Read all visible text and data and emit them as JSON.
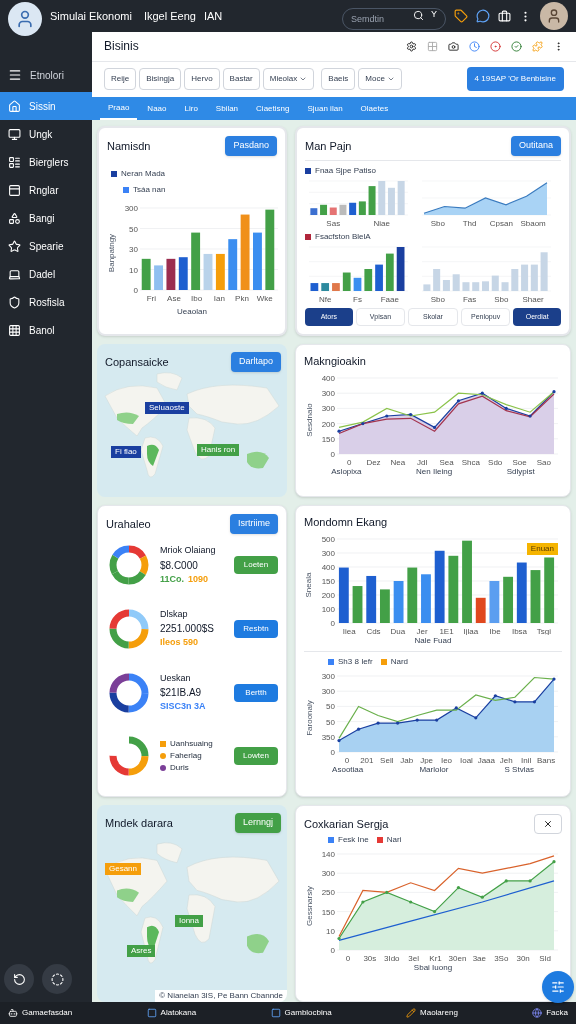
{
  "app": {
    "title": "Simulai Ekonomi",
    "subtitle": "Ikgel Eeng",
    "user_code": "IAN"
  },
  "search": {
    "placeholder": "Semdtin",
    "shortcut": "Y"
  },
  "sidebar": {
    "header": "Etnolori",
    "items": [
      {
        "label": "Sissin",
        "selected": true
      },
      {
        "label": "Ungk",
        "selected": false
      },
      {
        "label": "Bierglers",
        "selected": false
      },
      {
        "label": "Rnglar",
        "selected": false
      },
      {
        "label": "Bangi",
        "selected": false
      },
      {
        "label": "Spearie",
        "selected": false
      },
      {
        "label": "Dadel",
        "selected": false
      },
      {
        "label": "Rosfisla",
        "selected": false
      },
      {
        "label": "Banol",
        "selected": false
      }
    ]
  },
  "page": {
    "title": "Bisinis"
  },
  "toolbar": [
    {
      "label": "Reije",
      "kind": "plain"
    },
    {
      "label": "Bisingja",
      "kind": "plain"
    },
    {
      "label": "Hervo",
      "kind": "plain"
    },
    {
      "label": "Bastar",
      "kind": "plain"
    },
    {
      "label": "Mieolax",
      "kind": "dropdown"
    },
    {
      "label": "Baeis",
      "kind": "plain"
    },
    {
      "label": "Moce",
      "kind": "dropdown"
    },
    {
      "label": "4 19SAP 'Or Benbisine",
      "kind": "primary"
    }
  ],
  "tabs": [
    {
      "label": "Praao",
      "selected": true
    },
    {
      "label": "Naao",
      "selected": false
    },
    {
      "label": "Liro",
      "selected": false
    },
    {
      "label": "Sbilan",
      "selected": false
    },
    {
      "label": "Ciaetisng",
      "selected": false
    },
    {
      "label": "Sjuan ilan",
      "selected": false
    },
    {
      "label": "Olaetes",
      "selected": false
    }
  ],
  "bar_panel": {
    "title": "Namisdn",
    "button": "Pasdano",
    "legend": [
      {
        "label": "Neran Mada",
        "color": "#1a3fa0"
      },
      {
        "label": "Tsáa nan",
        "color": "#3b82f6"
      }
    ],
    "yticks": [
      "300",
      "50",
      "30",
      "10",
      "0"
    ],
    "xlabels": [
      "Fri",
      "Ase",
      "Ibo",
      "Ian",
      "Pkn",
      "Wke"
    ],
    "ylabel": "Banpatngy",
    "xlabel": "Ueaolan"
  },
  "multi_panel": {
    "title": "Man Pajn",
    "button": "Outitana",
    "legend_top": {
      "label": "Fnaa Sjpe Patiso",
      "color": "#1a3fa0"
    },
    "top_left_x": [
      "Sas",
      "Niae"
    ],
    "top_right_x": [
      "Sbo",
      "Thd",
      "Cpsan",
      "Sbaom"
    ],
    "legend_bottom": {
      "label": "Fsacfston BlelA",
      "color": "#b0263b"
    },
    "bottom_left_x": [
      "Nfe",
      "Fs",
      "Faae"
    ],
    "bottom_right_x": [
      "Sbo",
      "Fas",
      "Sbo",
      "Shaer"
    ],
    "segments": [
      {
        "label": "Ators",
        "selected": true
      },
      {
        "label": "Vpisan",
        "selected": false
      },
      {
        "label": "Skolar",
        "selected": false
      },
      {
        "label": "Penlopuv",
        "selected": false
      },
      {
        "label": "Oerdiat",
        "selected": true
      }
    ]
  },
  "map_panel": {
    "title": "Copansaicke",
    "button": "Darltapo",
    "labels": [
      {
        "text": "Seluaoste",
        "color": "#1a3fa0"
      },
      {
        "text": "Fi flao",
        "color": "#1a3fa0"
      },
      {
        "text": "Hanis ron",
        "color": "#43a047"
      }
    ]
  },
  "line_panel": {
    "title": "Makngioakin",
    "yticks": [
      "400",
      "300",
      "300",
      "200",
      "150",
      "0"
    ],
    "xlabels": [
      "0",
      "Dez",
      "Nea",
      "Jdl",
      "Sea",
      "Shca",
      "Sdo",
      "Soe",
      "Sao"
    ],
    "ylabel": "Sesdnalo",
    "groups": [
      "Aslopixa",
      "Nen Ileing",
      "Sdlypist"
    ]
  },
  "summary_panel": {
    "title": "Urahaleo",
    "button": "Isrtriime",
    "items": [
      {
        "kind": "stat",
        "title": "Mriok Olaiang",
        "value": "$8.C000",
        "detail": [
          {
            "text": "11Co.",
            "color": "#43a047"
          },
          {
            "text": "1090",
            "color": "#f59e0b"
          }
        ],
        "button": {
          "label": "Loeten",
          "color": "#43a047"
        }
      },
      {
        "kind": "stat",
        "title": "Dlskap",
        "value": "2251.000$S",
        "detail": [
          {
            "text": "Ileos 590",
            "color": "#f59e0b"
          }
        ],
        "button": {
          "label": "Resbtn",
          "color": "#1e7be0"
        }
      },
      {
        "kind": "stat",
        "title": "Ueskan",
        "value": "$21IB.A9",
        "detail": [
          {
            "text": "SISC3n 3A",
            "color": "#3b82f6"
          }
        ],
        "button": {
          "label": "Bertth",
          "color": "#1e7be0"
        }
      },
      {
        "kind": "legend",
        "legend": [
          {
            "label": "Uanhsuaing",
            "color": "#f59e0b",
            "round": false
          },
          {
            "label": "Faherlag",
            "color": "#f59e0b",
            "round": true
          },
          {
            "label": "Duris",
            "color": "#7b3f98",
            "round": true
          }
        ],
        "button": {
          "label": "Lowten",
          "color": "#43a047"
        }
      }
    ]
  },
  "combo_panel": {
    "title": "Mondomn Ekang",
    "badge": "Enuan",
    "bar_yticks": [
      "500",
      "300",
      "400",
      "150",
      "200",
      "100",
      "0"
    ],
    "bar_xlabels": [
      "Iiea",
      "Cds",
      "Dua",
      "Jer",
      "1E1",
      "Ijlaa",
      "Ibe",
      "Ibsa",
      "Tsgi"
    ],
    "bar_ylabel": "Sneala",
    "bar_xlabel": "Nale Fuad",
    "legend": [
      {
        "label": "Sh3 8 Iefr",
        "color": "#3b82f6"
      },
      {
        "label": "Nard",
        "color": "#f59e0b"
      }
    ],
    "line_yticks": [
      "300",
      "300",
      "50",
      "50",
      "350",
      "0"
    ],
    "line_xlabels": [
      "0",
      "201",
      "Sell",
      "Jab",
      "Jpe",
      "Ieo",
      "Ioal",
      "Jaaa",
      "Jeh",
      "Inil",
      "Bans"
    ],
    "line_ylabel": "Faroonaly",
    "groups": [
      "Asootiaa",
      "Marlolor",
      "S Stvlas"
    ]
  },
  "map_panel_2": {
    "title": "Mndek darara",
    "button": "Lernngj",
    "labels": [
      {
        "text": "Gesann",
        "color": "#f59e0b"
      },
      {
        "text": "Ionna",
        "color": "#43a047"
      },
      {
        "text": "Asres",
        "color": "#43a047"
      }
    ],
    "attribution": "© Nianeian 3IS, Pe Bann Cbannde"
  },
  "compare_panel": {
    "title": "Coxkarian Sergja",
    "legend": [
      {
        "label": "Fesk Ine",
        "color": "#3b82f6"
      },
      {
        "label": "Nari",
        "color": "#e53935"
      }
    ],
    "yticks": [
      "140",
      "300",
      "250",
      "150",
      "10",
      "0"
    ],
    "xlabels": [
      "0",
      "30s",
      "3Ido",
      "3el",
      "Kr1",
      "30en",
      "3ae",
      "3So",
      "30n",
      "Sld"
    ],
    "ylabel": "Gessnarsly",
    "xlabel": "Sbai Iuong"
  },
  "taskbar": [
    {
      "label": "Gamaefasdan"
    },
    {
      "label": "Alatokana"
    },
    {
      "label": "Gamblocbina"
    },
    {
      "label": "Maolareng"
    },
    {
      "label": "Facka"
    }
  ]
}
